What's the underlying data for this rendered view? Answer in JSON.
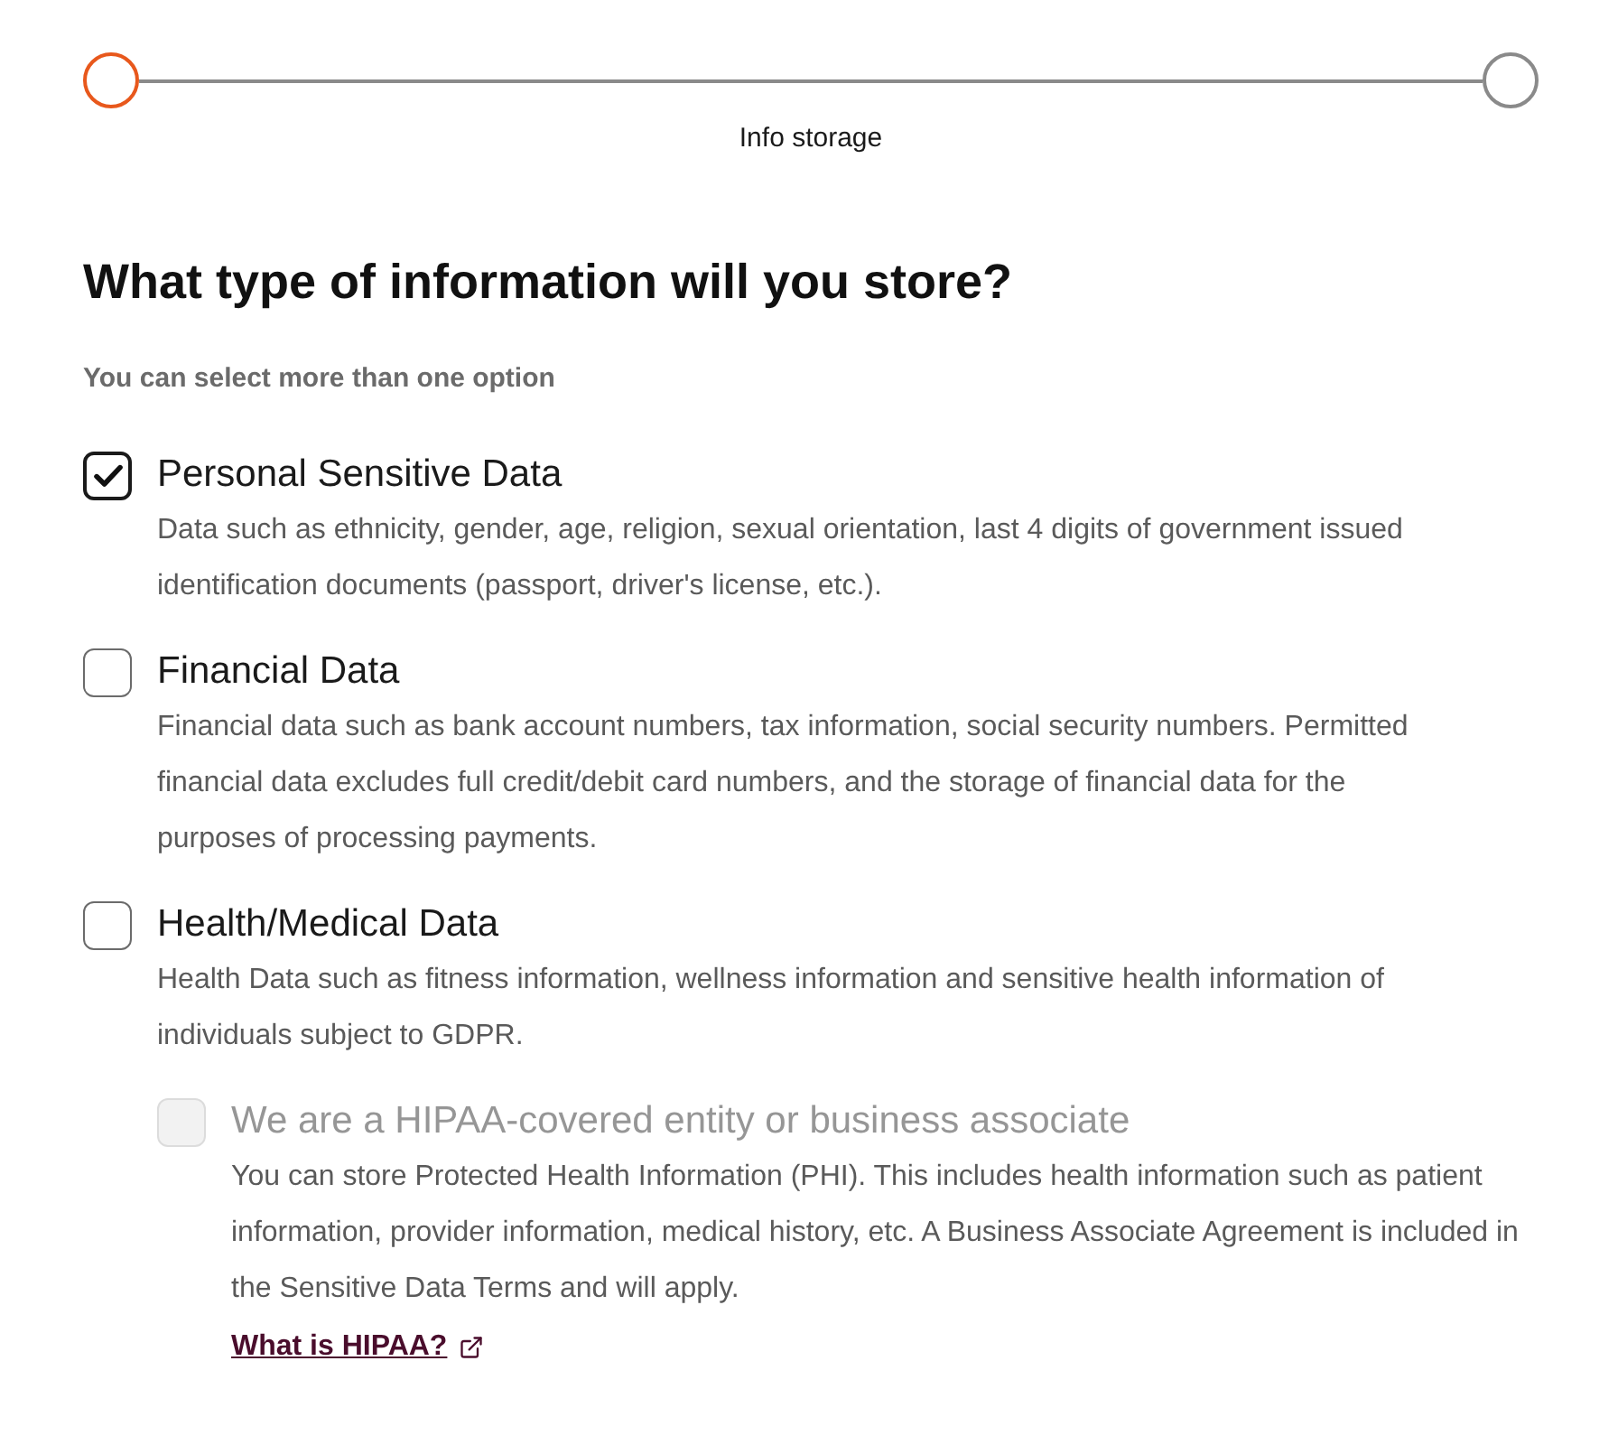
{
  "stepper": {
    "steps": [
      {
        "selected": true
      },
      {
        "selected": false
      }
    ],
    "label": "Info storage"
  },
  "question": {
    "title": "What type of information will you store?",
    "hint": "You can select more than one option"
  },
  "options": [
    {
      "label": "Personal Sensitive Data",
      "description": "Data such as ethnicity, gender, age, religion, sexual orientation, last 4 digits of government issued identification documents (passport, driver's license, etc.).",
      "checked": true,
      "disabled": false
    },
    {
      "label": "Financial Data",
      "description": "Financial data such as bank account numbers, tax information, social security numbers. Permitted financial data excludes full credit/debit card numbers, and the storage of financial data for the purposes of processing payments.",
      "checked": false,
      "disabled": false
    },
    {
      "label": "Health/Medical Data",
      "description": "Health Data such as fitness information, wellness information and sensitive health information of individuals subject to GDPR.",
      "checked": false,
      "disabled": false,
      "children": [
        {
          "label": "We are a HIPAA-covered entity or business associate",
          "description": "You can store Protected Health Information (PHI). This includes health information such as patient information, provider information, medical history, etc. A Business Associate Agreement is included in the Sensitive Data Terms and will apply.",
          "checked": false,
          "disabled": true,
          "link": "What is HIPAA?"
        }
      ]
    }
  ]
}
